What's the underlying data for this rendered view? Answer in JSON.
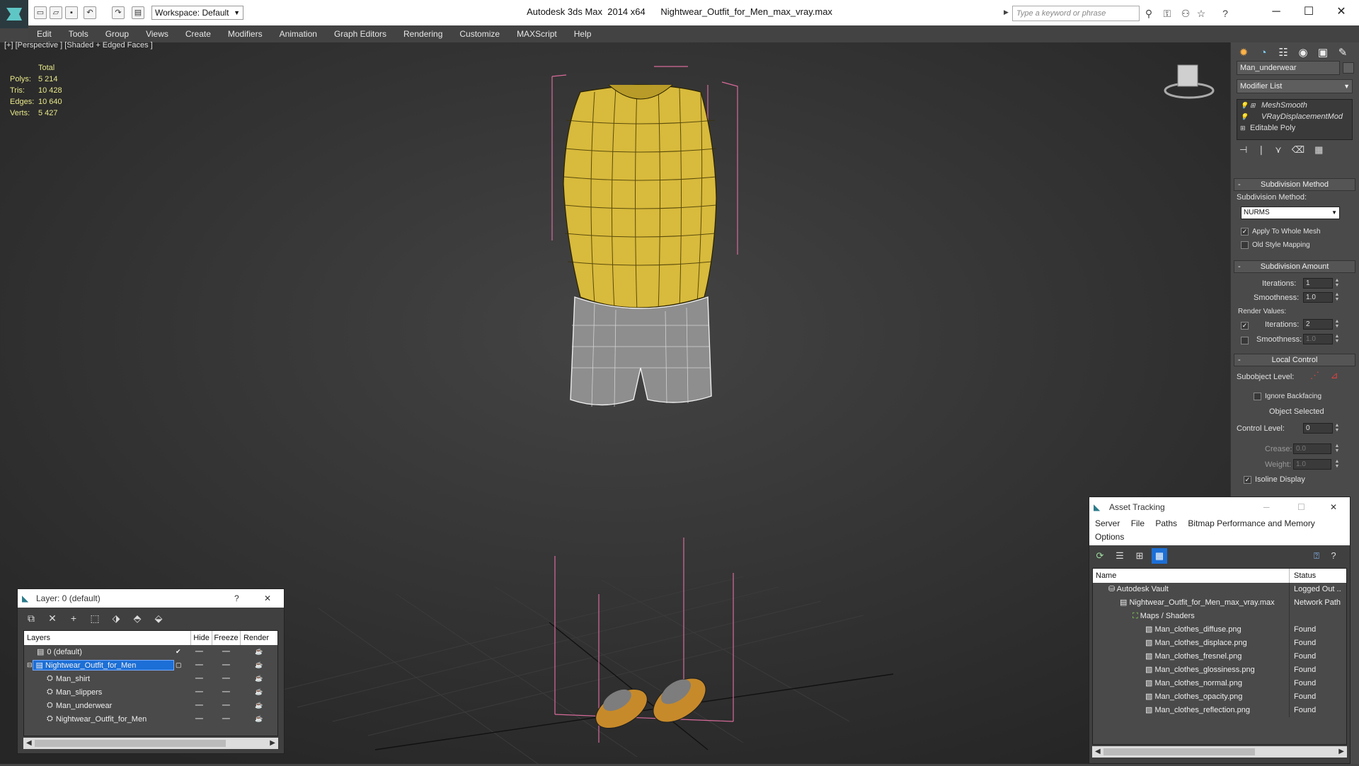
{
  "titlebar": {
    "workspace": "Workspace: Default",
    "title": "Autodesk 3ds Max  2014 x64      Nightwear_Outfit_for_Men_max_vray.max",
    "search_placeholder": "Type a keyword or phrase",
    "minimize": "─",
    "maximize": "☐",
    "close": "✕"
  },
  "menu": [
    "Edit",
    "Tools",
    "Group",
    "Views",
    "Create",
    "Modifiers",
    "Animation",
    "Graph Editors",
    "Rendering",
    "Customize",
    "MAXScript",
    "Help"
  ],
  "viewport": {
    "label": "[+] [Perspective ] [Shaded + Edged Faces ]",
    "stats_header": "Total",
    "stats": [
      {
        "k": "Polys:",
        "v": "5 214"
      },
      {
        "k": "Tris:",
        "v": "10 428"
      },
      {
        "k": "Edges:",
        "v": "10 640"
      },
      {
        "k": "Verts:",
        "v": "5 427"
      }
    ]
  },
  "command_panel": {
    "object_name": "Man_underwear",
    "modifier_list": "Modifier List",
    "stack": [
      "MeshSmooth",
      "VRayDisplacementMod",
      "Editable Poly"
    ],
    "subdivision_method_title": "Subdivision Method",
    "subdivision_method_label": "Subdivision Method:",
    "subdivision_method_value": "NURMS",
    "apply_whole_mesh": "Apply To Whole Mesh",
    "old_style_mapping": "Old Style Mapping",
    "subdivision_amount_title": "Subdivision Amount",
    "iterations_label": "Iterations:",
    "iterations_value": "1",
    "smoothness_label": "Smoothness:",
    "smoothness_value": "1.0",
    "render_values": "Render Values:",
    "render_iterations_value": "2",
    "render_smoothness_value": "1.0",
    "local_control_title": "Local Control",
    "subobject_level": "Subobject Level:",
    "ignore_backfacing": "Ignore Backfacing",
    "object_selected": "Object Selected",
    "control_level_label": "Control Level:",
    "control_level_value": "0",
    "crease_label": "Crease:",
    "crease_value": "0.0",
    "weight_label": "Weight:",
    "weight_value": "1.0",
    "isoline_display": "Isoline Display"
  },
  "layer_window": {
    "title": "Layer: 0 (default)",
    "help": "?",
    "close": "✕",
    "headers": [
      "Layers",
      "Hide",
      "Freeze",
      "Render"
    ],
    "rows": [
      {
        "name": "0 (default)",
        "indent": 1
      },
      {
        "name": "Nightwear_Outfit_for_Men",
        "indent": 0
      },
      {
        "name": "Man_shirt",
        "indent": 2
      },
      {
        "name": "Man_slippers",
        "indent": 2
      },
      {
        "name": "Man_underwear",
        "indent": 2
      },
      {
        "name": "Nightwear_Outfit_for_Men",
        "indent": 2
      }
    ]
  },
  "asset_window": {
    "title": "Asset Tracking",
    "menu": [
      "Server",
      "File",
      "Paths",
      "Bitmap Performance and Memory",
      "Options"
    ],
    "headers": [
      "Name",
      "Status"
    ],
    "rows": [
      {
        "name": "Autodesk Vault",
        "status": "Logged Out ..",
        "indent": 1
      },
      {
        "name": "Nightwear_Outfit_for_Men_max_vray.max",
        "status": "Network Path",
        "indent": 2
      },
      {
        "name": "Maps / Shaders",
        "status": "",
        "indent": 3
      },
      {
        "name": "Man_clothes_diffuse.png",
        "status": "Found",
        "indent": 4
      },
      {
        "name": "Man_clothes_displace.png",
        "status": "Found",
        "indent": 4
      },
      {
        "name": "Man_clothes_fresnel.png",
        "status": "Found",
        "indent": 4
      },
      {
        "name": "Man_clothes_glossiness.png",
        "status": "Found",
        "indent": 4
      },
      {
        "name": "Man_clothes_normal.png",
        "status": "Found",
        "indent": 4
      },
      {
        "name": "Man_clothes_opacity.png",
        "status": "Found",
        "indent": 4
      },
      {
        "name": "Man_clothes_reflection.png",
        "status": "Found",
        "indent": 4
      }
    ]
  }
}
